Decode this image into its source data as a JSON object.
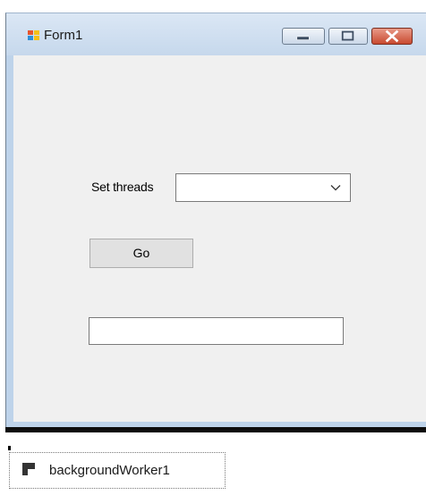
{
  "window": {
    "title": "Form1",
    "app_icon": "winforms-form-icon",
    "controls": {
      "minimize_icon": "minimize-icon",
      "maximize_icon": "maximize-icon",
      "close_icon": "close-icon"
    }
  },
  "form": {
    "threads_label": "Set threads",
    "threads_combo_value": "",
    "threads_combo_icon": "chevron-down-icon",
    "go_label": "Go",
    "output_text": ""
  },
  "component_tray": {
    "items": [
      {
        "label": "backgroundWorker1",
        "icon": "background-worker-icon"
      }
    ]
  },
  "colors": {
    "form_background": "#f0f0f0",
    "window_frame": "#bed3ea",
    "close_button": "#c84a30"
  }
}
